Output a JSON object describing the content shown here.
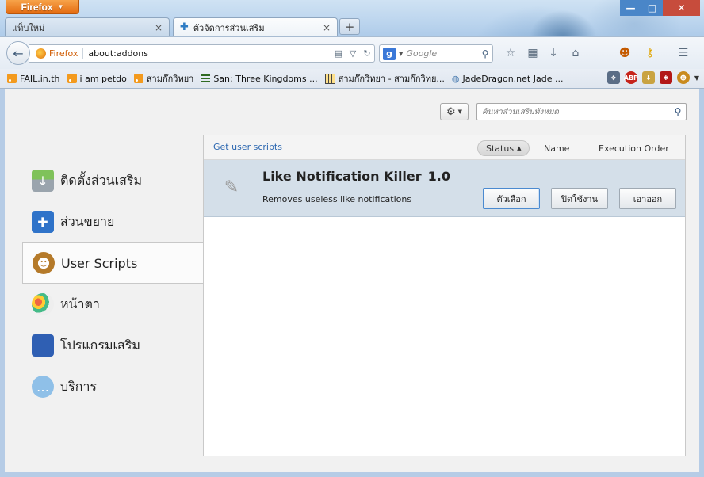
{
  "window": {
    "app_menu_label": "Firefox",
    "minimize": "—",
    "maximize": "□",
    "close": "✕"
  },
  "tabs": [
    {
      "label": "แท็บใหม่",
      "close": "×"
    },
    {
      "label": "ตัวจัดการส่วนเสริม",
      "close": "×",
      "favicon": "puzzle-icon"
    }
  ],
  "new_tab_label": "+",
  "navbar": {
    "identity_label": "Firefox",
    "url": "about:addons",
    "search_placeholder": "Google"
  },
  "bookmarks": [
    {
      "label": "FAIL.in.th",
      "icon": "rss-icon"
    },
    {
      "label": "i am petdo",
      "icon": "rss-icon"
    },
    {
      "label": "สามก๊กวิทยา",
      "icon": "rss-icon"
    },
    {
      "label": "San: Three Kingdoms ...",
      "icon": "bars-icon"
    },
    {
      "label": "สามก๊กวิทยา - สามก๊กวิทย...",
      "icon": "grid-icon"
    },
    {
      "label": "JadeDragon.net Jade ...",
      "icon": "globe-icon"
    }
  ],
  "toolbar_icons": {
    "abp": "ABP"
  },
  "addons_manager": {
    "search_placeholder": "ค้นหาส่วนเสริมทั้งหมด",
    "categories": [
      {
        "label": "ติดตั้งส่วนเสริม",
        "icon": "download-icon"
      },
      {
        "label": "ส่วนขยาย",
        "icon": "puzzle-icon"
      },
      {
        "label": "User Scripts",
        "icon": "greasemonkey-icon",
        "selected": true
      },
      {
        "label": "หน้าตา",
        "icon": "palette-icon"
      },
      {
        "label": "โปรแกรมเสริม",
        "icon": "lego-icon"
      },
      {
        "label": "บริการ",
        "icon": "chat-icon"
      }
    ],
    "header": {
      "get_link": "Get user scripts",
      "sort_status": "Status",
      "sort_name": "Name",
      "sort_order": "Execution Order"
    },
    "addon": {
      "name": "Like Notification Killer",
      "version": "1.0",
      "description": "Removes useless like notifications",
      "btn_options": "ตัวเลือก",
      "btn_disable": "ปิดใช้งาน",
      "btn_remove": "เอาออก"
    }
  },
  "colors": {
    "firefox_orange": "#e46b10",
    "selection_row": "#d4dfe9",
    "link_blue": "#2a66b0"
  }
}
